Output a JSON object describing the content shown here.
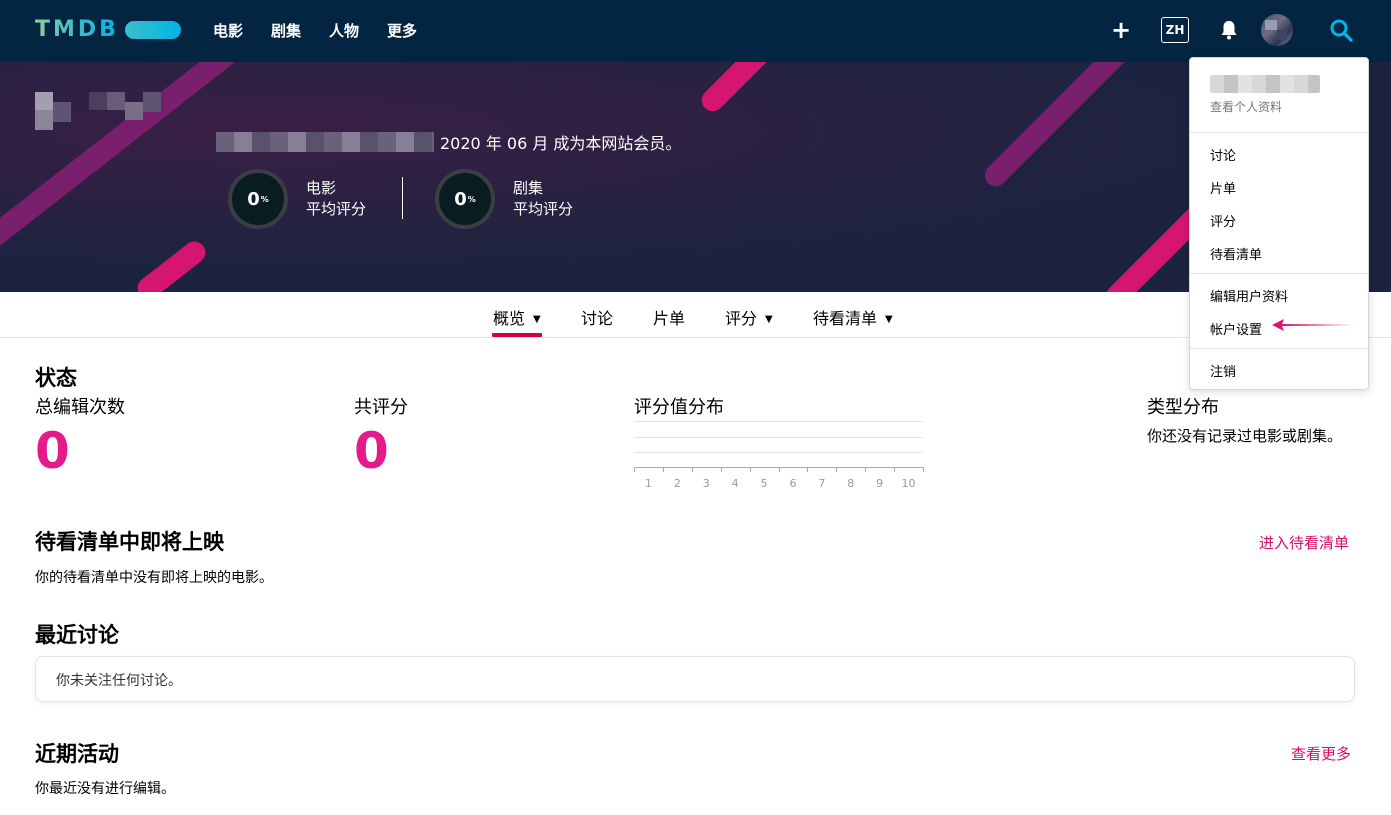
{
  "nav": {
    "logo": "TMDB",
    "links": [
      "电影",
      "剧集",
      "人物",
      "更多"
    ],
    "lang": "ZH",
    "plus_icon": "plus-icon",
    "bell_icon": "bell-icon",
    "search_icon": "search-icon"
  },
  "profile": {
    "member_text": "2020 年 06 月 成为本网站会员。",
    "scores": [
      {
        "value": "0",
        "unit": "%",
        "line1": "电影",
        "line2": "平均评分"
      },
      {
        "value": "0",
        "unit": "%",
        "line1": "剧集",
        "line2": "平均评分"
      }
    ]
  },
  "tabs": [
    {
      "label": "概览",
      "has_caret": true,
      "active": true
    },
    {
      "label": "讨论",
      "has_caret": false
    },
    {
      "label": "片单",
      "has_caret": false
    },
    {
      "label": "评分",
      "has_caret": true
    },
    {
      "label": "待看清单",
      "has_caret": true
    }
  ],
  "stats": {
    "title": "状态",
    "total_edits_label": "总编辑次数",
    "total_edits": "0",
    "total_ratings_label": "共评分",
    "total_ratings": "0",
    "rating_dist_label": "评分值分布",
    "rating_ticks": [
      "1",
      "2",
      "3",
      "4",
      "5",
      "6",
      "7",
      "8",
      "9",
      "10"
    ],
    "genre_label": "类型分布",
    "genre_empty": "你还没有记录过电影或剧集。"
  },
  "upcoming": {
    "title": "待看清单中即将上映",
    "link": "进入待看清单",
    "empty": "你的待看清单中没有即将上映的电影。"
  },
  "discussions": {
    "title": "最近讨论",
    "empty": "你未关注任何讨论。"
  },
  "activity": {
    "title": "近期活动",
    "link": "查看更多",
    "empty": "你最近没有进行编辑。"
  },
  "dropdown": {
    "view_profile": "查看个人资料",
    "group1": [
      "讨论",
      "片单",
      "评分",
      "待看清单"
    ],
    "group2": [
      "编辑用户资料",
      "帐户设置"
    ],
    "logout": "注销"
  },
  "colors": {
    "nav_bg": "#032541",
    "accent_pink": "#e51a8a",
    "link_pink": "#d40f6c",
    "tab_underline": "#d40242"
  }
}
